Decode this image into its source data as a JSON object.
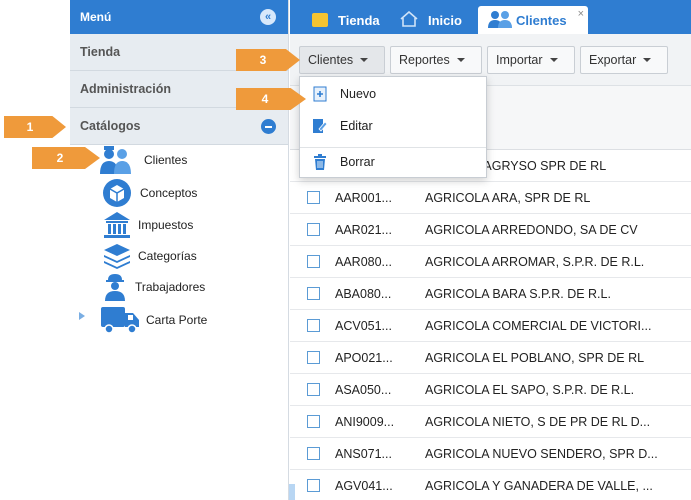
{
  "sidebar": {
    "menu_title": "Menú",
    "collapse_icon": "double-chevron-left-icon",
    "sections": [
      {
        "label": "Tienda"
      },
      {
        "label": "Administración"
      },
      {
        "label": "Catálogos"
      }
    ],
    "tree_items": [
      {
        "label": "Clientes",
        "icon": "clients-icon"
      },
      {
        "label": "Conceptos",
        "icon": "box-icon"
      },
      {
        "label": "Impuestos",
        "icon": "bank-icon"
      },
      {
        "label": "Categorías",
        "icon": "layers-icon"
      },
      {
        "label": "Trabajadores",
        "icon": "worker-icon"
      },
      {
        "label": "Carta Porte",
        "icon": "truck-icon"
      }
    ]
  },
  "tabs": [
    {
      "label": "Tienda",
      "icon": "store-icon"
    },
    {
      "label": "Inicio",
      "icon": "home-icon"
    },
    {
      "label": "Clientes",
      "icon": "clients-icon",
      "active": true,
      "close": "×"
    }
  ],
  "toolbar": {
    "clientes_label": "Clientes",
    "reportes_label": "Reportes",
    "importar_label": "Importar",
    "exportar_label": "Exportar"
  },
  "dropdown": {
    "items": [
      {
        "label": "Nuevo",
        "icon": "new-file-icon"
      },
      {
        "label": "Editar",
        "icon": "edit-icon"
      },
      {
        "label": "Borrar",
        "icon": "trash-icon"
      }
    ]
  },
  "callouts": [
    "1",
    "2",
    "3",
    "4"
  ],
  "grid": {
    "rows": [
      {
        "code": "",
        "name": "A AGRYSO SPR DE RL"
      },
      {
        "code": "AAR001...",
        "name": "AGRICOLA ARA, SPR DE RL"
      },
      {
        "code": "AAR021...",
        "name": "AGRICOLA ARREDONDO, SA DE CV"
      },
      {
        "code": "AAR080...",
        "name": "AGRICOLA ARROMAR, S.P.R. DE R.L."
      },
      {
        "code": "ABA080...",
        "name": "AGRICOLA BARA S.P.R. DE R.L."
      },
      {
        "code": "ACV051...",
        "name": "AGRICOLA COMERCIAL DE VICTORI..."
      },
      {
        "code": "APO021...",
        "name": "AGRICOLA EL POBLANO, SPR DE RL"
      },
      {
        "code": "ASA050...",
        "name": "AGRICOLA EL SAPO, S.P.R. DE R.L."
      },
      {
        "code": "ANI9009...",
        "name": "AGRICOLA NIETO, S DE PR DE RL D..."
      },
      {
        "code": "ANS071...",
        "name": "AGRICOLA NUEVO SENDERO, SPR D..."
      },
      {
        "code": "AGV041...",
        "name": "AGRICOLA Y GANADERA DE VALLE, ..."
      }
    ]
  },
  "colors": {
    "brand_blue": "#2f7dd1",
    "callout_orange": "#ef9a3b",
    "sidebar_section_bg": "#e7ecf1"
  }
}
